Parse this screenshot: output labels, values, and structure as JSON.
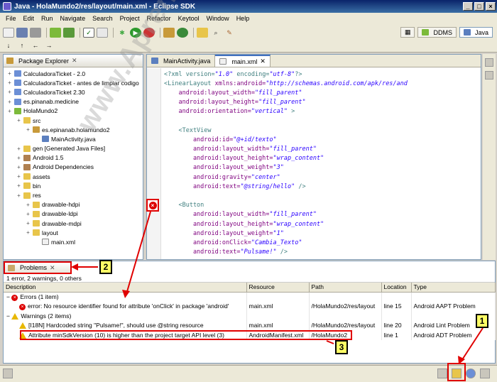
{
  "window": {
    "title": "Java - HolaMundo2/res/layout/main.xml - Eclipse SDK"
  },
  "menu": [
    "File",
    "Edit",
    "Run",
    "Navigate",
    "Search",
    "Project",
    "Refactor",
    "Keytool",
    "Window",
    "Help"
  ],
  "perspectives": [
    "DDMS",
    "Java"
  ],
  "package_explorer": {
    "title": "Package Explorer",
    "items": [
      {
        "label": "CalculadoraTicket - 2.0",
        "depth": 0,
        "icon": "project-icon"
      },
      {
        "label": "CalculadoraTicket - antes de limpiar codigo",
        "depth": 0,
        "icon": "project-icon"
      },
      {
        "label": "CalculadoraTicket 2.30",
        "depth": 0,
        "icon": "project-icon"
      },
      {
        "label": "es.pinanab.medicine",
        "depth": 0,
        "icon": "project-icon"
      },
      {
        "label": "HolaMundo2",
        "depth": 0,
        "icon": "android-project-icon"
      },
      {
        "label": "src",
        "depth": 1,
        "icon": "source-folder-icon"
      },
      {
        "label": "es.epinanab.holamundo2",
        "depth": 2,
        "icon": "package-icon"
      },
      {
        "label": "MainActivity.java",
        "depth": 3,
        "icon": "java-file-icon"
      },
      {
        "label": "gen [Generated Java Files]",
        "depth": 1,
        "icon": "source-folder-icon"
      },
      {
        "label": "Android 1.5",
        "depth": 1,
        "icon": "library-icon"
      },
      {
        "label": "Android Dependencies",
        "depth": 1,
        "icon": "library-icon"
      },
      {
        "label": "assets",
        "depth": 1,
        "icon": "folder-icon"
      },
      {
        "label": "bin",
        "depth": 1,
        "icon": "folder-icon"
      },
      {
        "label": "res",
        "depth": 1,
        "icon": "folder-icon"
      },
      {
        "label": "drawable-hdpi",
        "depth": 2,
        "icon": "folder-icon"
      },
      {
        "label": "drawable-ldpi",
        "depth": 2,
        "icon": "folder-icon"
      },
      {
        "label": "drawable-mdpi",
        "depth": 2,
        "icon": "folder-icon"
      },
      {
        "label": "layout",
        "depth": 2,
        "icon": "folder-icon"
      },
      {
        "label": "main.xml",
        "depth": 3,
        "icon": "xml-file-icon"
      }
    ]
  },
  "editor": {
    "tabs": [
      "MainActivity.java",
      "main.xml"
    ],
    "code_lines": [
      [
        [
          "pi",
          "<?xml version="
        ],
        [
          "val",
          "\"1.0\""
        ],
        [
          "pi",
          " encoding="
        ],
        [
          "val",
          "\"utf-8\""
        ],
        [
          "pi",
          "?>"
        ]
      ],
      [
        [
          "tag",
          "<LinearLayout "
        ],
        [
          "attr",
          "xmlns:android="
        ],
        [
          "val",
          "\"http://schemas.android.com/apk/res/and"
        ]
      ],
      [
        [
          "attr",
          "    android:layout_width="
        ],
        [
          "val",
          "\"fill_parent\""
        ]
      ],
      [
        [
          "attr",
          "    android:layout_height="
        ],
        [
          "val",
          "\"fill_parent\""
        ]
      ],
      [
        [
          "attr",
          "    android:orientation="
        ],
        [
          "val",
          "\"vertical\""
        ],
        [
          "tag",
          " >"
        ]
      ],
      [
        [
          "tag",
          ""
        ]
      ],
      [
        [
          "tag",
          "    <TextView"
        ]
      ],
      [
        [
          "attr",
          "        android:id="
        ],
        [
          "val",
          "\"@+id/texto\""
        ]
      ],
      [
        [
          "attr",
          "        android:layout_width="
        ],
        [
          "val",
          "\"fill_parent\""
        ]
      ],
      [
        [
          "attr",
          "        android:layout_height="
        ],
        [
          "val",
          "\"wrap_content\""
        ]
      ],
      [
        [
          "attr",
          "        android:layout_weight="
        ],
        [
          "val",
          "\"3\""
        ]
      ],
      [
        [
          "attr",
          "        android:gravity="
        ],
        [
          "val",
          "\"center\""
        ]
      ],
      [
        [
          "attr",
          "        android:text="
        ],
        [
          "val",
          "\"@string/hello\""
        ],
        [
          "tag",
          " />"
        ]
      ],
      [
        [
          "tag",
          ""
        ]
      ],
      [
        [
          "tag",
          "    <Button"
        ]
      ],
      [
        [
          "attr",
          "        android:layout_width="
        ],
        [
          "val",
          "\"fill_parent\""
        ]
      ],
      [
        [
          "attr",
          "        android:layout_height="
        ],
        [
          "val",
          "\"wrap_content\""
        ]
      ],
      [
        [
          "attr",
          "        android:layout_weight="
        ],
        [
          "val",
          "\"1\""
        ]
      ],
      [
        [
          "attr",
          "        android:onClick="
        ],
        [
          "val",
          "\"Cambia_Texto\""
        ]
      ],
      [
        [
          "attr",
          "        android:text="
        ],
        [
          "val",
          "\"Pulsame!\""
        ],
        [
          "tag",
          " />"
        ]
      ]
    ]
  },
  "problems": {
    "tab_label": "Problems",
    "summary": "1 error, 2 warnings, 0 others",
    "columns": [
      "Description",
      "Resource",
      "Path",
      "Location",
      "Type"
    ],
    "rows": [
      {
        "kind": "group-error",
        "description": "Errors (1 item)",
        "resource": "",
        "path": "",
        "location": "",
        "type": ""
      },
      {
        "kind": "error",
        "description": "error: No resource identifier found for attribute 'onClick' in package 'android'",
        "resource": "main.xml",
        "path": "/HolaMundo2/res/layout",
        "location": "line 15",
        "type": "Android AAPT Problem"
      },
      {
        "kind": "group-warning",
        "description": "Warnings (2 items)",
        "resource": "",
        "path": "",
        "location": "",
        "type": ""
      },
      {
        "kind": "warning",
        "description": "[I18N] Hardcoded string \"Pulsame!\", should use @string resource",
        "resource": "main.xml",
        "path": "/HolaMundo2/res/layout",
        "location": "line 20",
        "type": "Android Lint Problem"
      },
      {
        "kind": "warning",
        "description": "Attribute minSdkVersion (10) is higher than the project target API level (3)",
        "resource": "AndroidManifest.xml",
        "path": "/HolaMundo2",
        "location": "line 1",
        "type": "Android ADT Problem"
      }
    ]
  },
  "callouts": [
    "1",
    "2",
    "3"
  ],
  "watermark": "www.AprendeAndroid.com",
  "annotation_color": "#e00000"
}
